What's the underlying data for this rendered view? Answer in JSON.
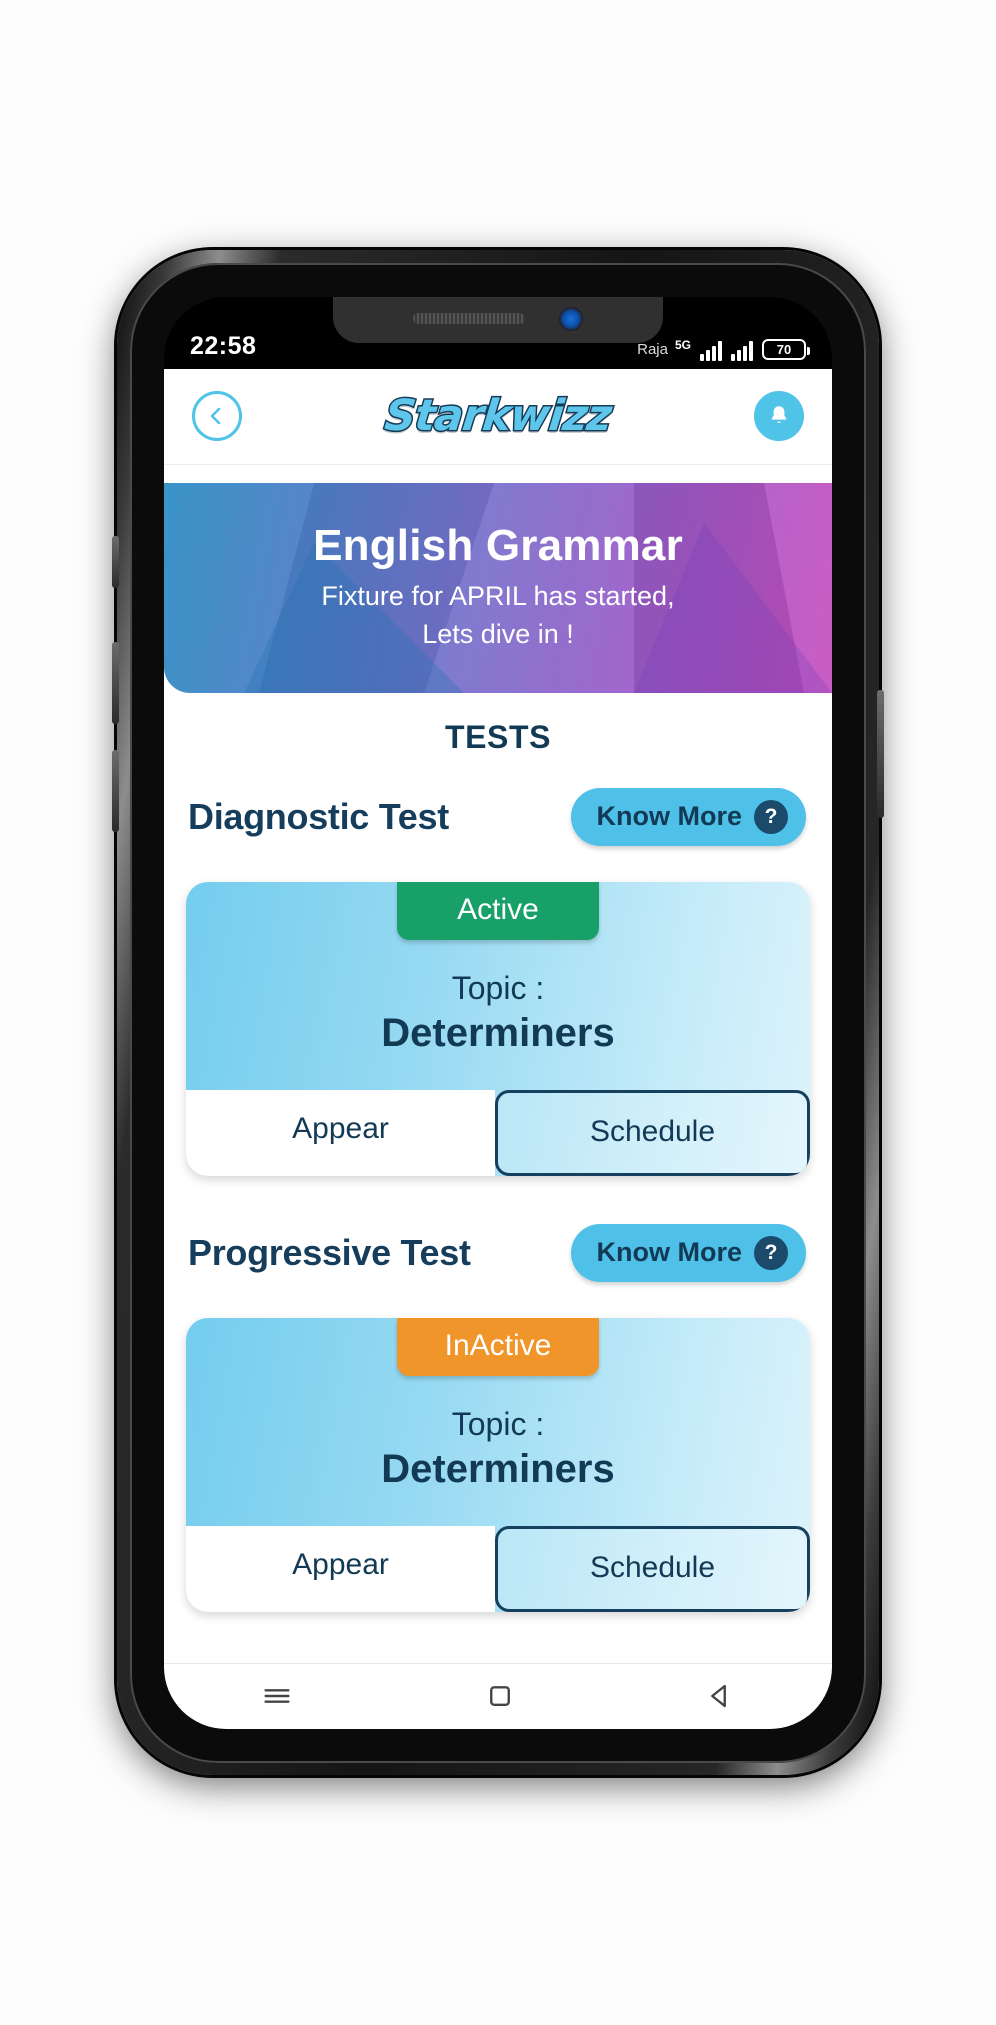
{
  "status_bar": {
    "time": "22:58",
    "carrier": "Raja",
    "network_type": "5G",
    "battery_level": "70",
    "icons": [
      "signal-bars-icon",
      "signal-bars-icon",
      "battery-icon"
    ]
  },
  "header": {
    "back_icon": "chevron-left-icon",
    "logo_text": "Starkwizz",
    "notification_icon": "bell-icon"
  },
  "hero": {
    "title": "English Grammar",
    "subtitle_line1": "Fixture for APRIL has started,",
    "subtitle_line2": "Lets dive in !"
  },
  "main": {
    "section_title": "TESTS",
    "tests": [
      {
        "name": "Diagnostic Test",
        "know_more_label": "Know More",
        "know_more_badge": "?",
        "card": {
          "status": "Active",
          "status_color": "#17a068",
          "topic_label": "Topic :",
          "topic_value": "Determiners",
          "primary_action": "Appear",
          "secondary_action": "Schedule"
        }
      },
      {
        "name": "Progressive Test",
        "know_more_label": "Know More",
        "know_more_badge": "?",
        "card": {
          "status": "InActive",
          "status_color": "#f0952a",
          "topic_label": "Topic :",
          "topic_value": "Determiners",
          "primary_action": "Appear",
          "secondary_action": "Schedule"
        }
      }
    ]
  },
  "nav_bar": {
    "recents_icon": "hamburger-icon",
    "home_icon": "square-icon",
    "back_icon": "triangle-back-icon"
  },
  "colors": {
    "accent": "#4fc1e9",
    "navy": "#123a55",
    "active_green": "#17a068",
    "inactive_orange": "#f0952a"
  }
}
